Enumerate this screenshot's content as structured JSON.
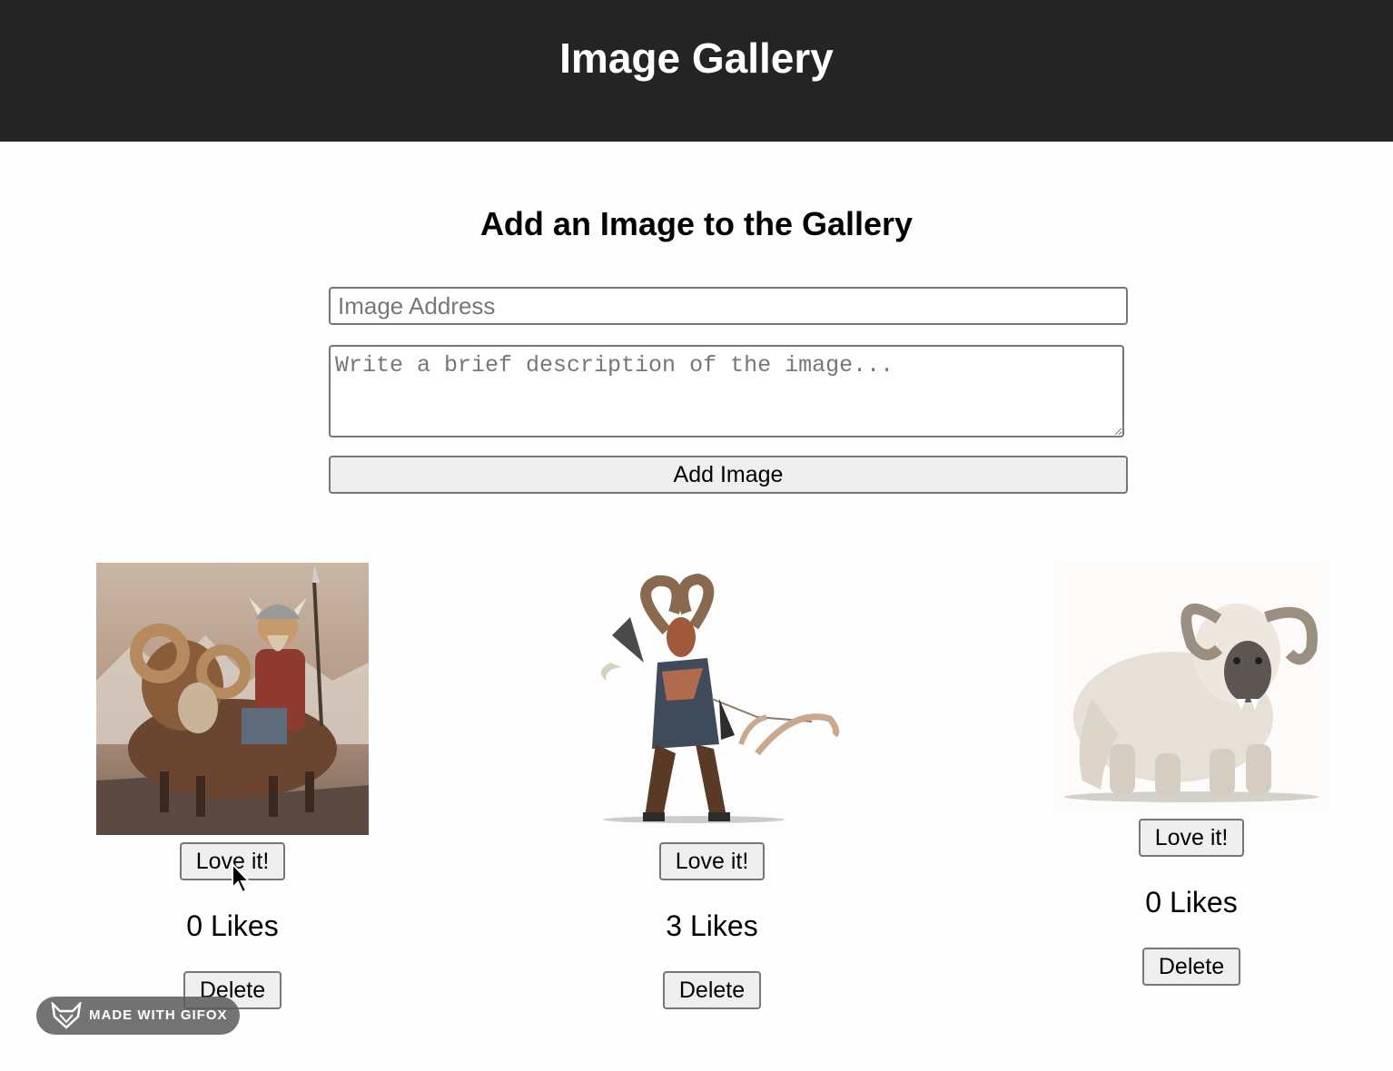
{
  "header": {
    "title": "Image Gallery"
  },
  "form": {
    "title": "Add an Image to the Gallery",
    "url_placeholder": "Image Address",
    "url_value": "",
    "description_placeholder": "Write a brief description of the image...",
    "description_value": "",
    "submit_label": "Add Image"
  },
  "gallery": {
    "items": [
      {
        "image": "viking-dwarf-riding-ram-illustration",
        "love_label": "Love it!",
        "likes_text": "0 Likes",
        "likes": 0,
        "delete_label": "Delete"
      },
      {
        "image": "ram-horned-satyr-archer-illustration",
        "love_label": "Love it!",
        "likes_text": "3 Likes",
        "likes": 3,
        "delete_label": "Delete"
      },
      {
        "image": "shaggy-white-ram-beast-illustration",
        "love_label": "Love it!",
        "likes_text": "0 Likes",
        "likes": 0,
        "delete_label": "Delete"
      }
    ]
  },
  "watermark": {
    "text": "MADE WITH GIFOX",
    "icon": "fox-icon"
  },
  "colors": {
    "header_bg": "#242424",
    "header_text": "#ffffff",
    "button_bg": "#efefef",
    "border": "#767676"
  }
}
